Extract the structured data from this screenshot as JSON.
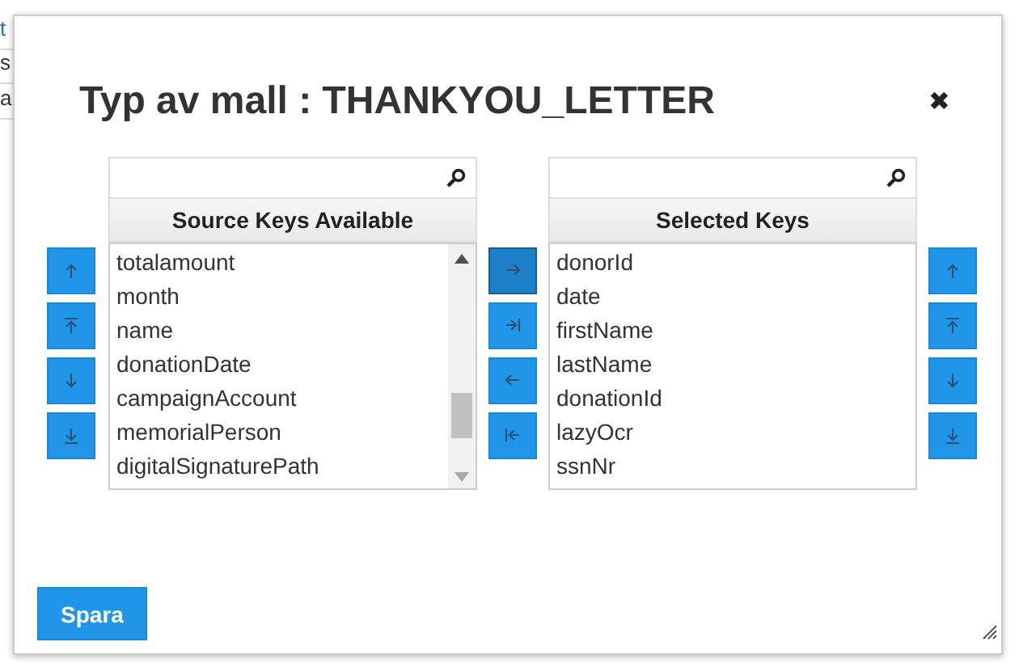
{
  "background_table": {
    "cells": [
      "t",
      "s",
      "a"
    ]
  },
  "dialog": {
    "title": "Typ av mall : THANKYOU_LETTER",
    "close": "✖",
    "left_buttons": [
      {
        "kind": "up",
        "active": false
      },
      {
        "kind": "top",
        "active": false
      },
      {
        "kind": "down",
        "active": false
      },
      {
        "kind": "bottom",
        "active": false
      }
    ],
    "source_list": {
      "header": "Source Keys Available",
      "items": [
        "totalamount",
        "month",
        "name",
        "donationDate",
        "campaignAccount",
        "memorialPerson",
        "digitalSignaturePath"
      ]
    },
    "middle_buttons": [
      {
        "kind": "right",
        "active": true
      },
      {
        "kind": "all-right",
        "active": false
      },
      {
        "kind": "left",
        "active": false
      },
      {
        "kind": "all-left",
        "active": false
      }
    ],
    "selected_list": {
      "header": "Selected Keys",
      "items": [
        "donorId",
        "date",
        "firstName",
        "lastName",
        "donationId",
        "lazyOcr",
        "ssnNr"
      ]
    },
    "right_buttons": [
      {
        "kind": "up",
        "active": false
      },
      {
        "kind": "top",
        "active": false
      },
      {
        "kind": "down",
        "active": false
      },
      {
        "kind": "bottom",
        "active": false
      }
    ],
    "save_button": "Spara"
  }
}
